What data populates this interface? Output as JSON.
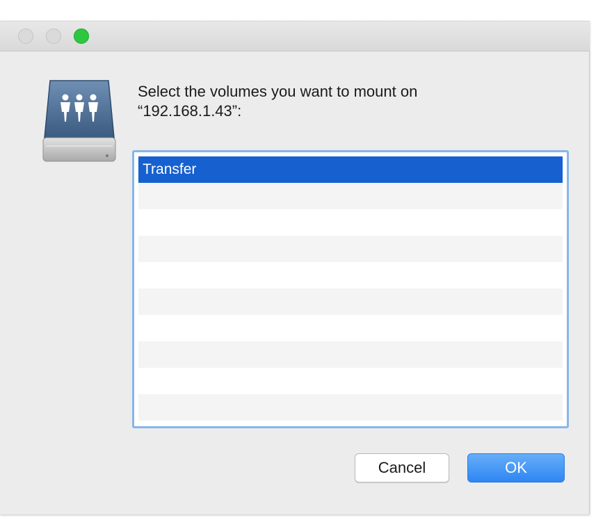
{
  "window": {
    "buttons": [
      "close",
      "minimize",
      "zoom"
    ]
  },
  "dialog": {
    "icon": "network-server-icon",
    "prompt_line1": "Select the volumes you want to mount on",
    "prompt_line2": "“192.168.1.43”:",
    "volumes": [
      "Transfer"
    ],
    "selected_volume": "Transfer",
    "cancel_label": "Cancel",
    "ok_label": "OK"
  },
  "colors": {
    "selection": "#1660d0",
    "ok_button": "#2f86f2",
    "zoom_button": "#2dc840",
    "focus_ring": "#86b6ea"
  }
}
